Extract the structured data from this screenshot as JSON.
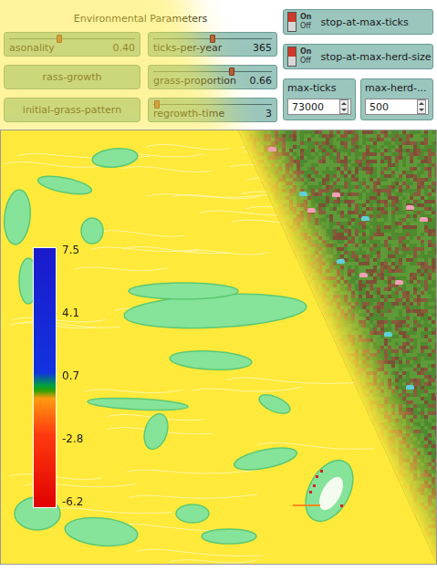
{
  "panel": {
    "title": "Environmental Parameters"
  },
  "widgets": [
    {
      "kind": "slider",
      "label": "asonality",
      "value": "0.40",
      "level": 0.4
    },
    {
      "kind": "slider",
      "label": "ticks-per-year",
      "value": "365",
      "level": 0.5
    },
    {
      "kind": "button",
      "label": "rass-growth"
    },
    {
      "kind": "slider",
      "label": "grass-proportion",
      "value": "0.66",
      "level": 0.66
    },
    {
      "kind": "button",
      "label": "initial-grass-pattern"
    },
    {
      "kind": "slider",
      "label": "regrowth-time",
      "value": "3",
      "level": 0.03
    }
  ],
  "switches": [
    {
      "label": "stop-at-max-ticks",
      "on_text": "On",
      "off_text": "Off",
      "on": true
    },
    {
      "label": "stop-at-max-herd-size",
      "on_text": "On",
      "off_text": "Off",
      "on": true
    }
  ],
  "inputs": [
    {
      "label": "max-ticks",
      "value": "73000"
    },
    {
      "label": "max-herd-...",
      "value": "500"
    }
  ],
  "legend": {
    "ticks": [
      "7.5",
      "4.1",
      "0.7",
      "-2.8",
      "-6.2"
    ]
  },
  "herd": [
    {
      "color": "#f2a0b8"
    },
    {
      "color": "#5fd0d8"
    },
    {
      "color": "#f2a0b8"
    },
    {
      "color": "#5fd0d8"
    },
    {
      "color": "#f2a0b8"
    },
    {
      "color": "#f2a0b8"
    },
    {
      "color": "#5fd0d8"
    },
    {
      "color": "#f2a0b8"
    },
    {
      "color": "#5fd0d8"
    },
    {
      "color": "#f2a0b8"
    },
    {
      "color": "#f2a0b8"
    },
    {
      "color": "#5fd0d8"
    }
  ]
}
